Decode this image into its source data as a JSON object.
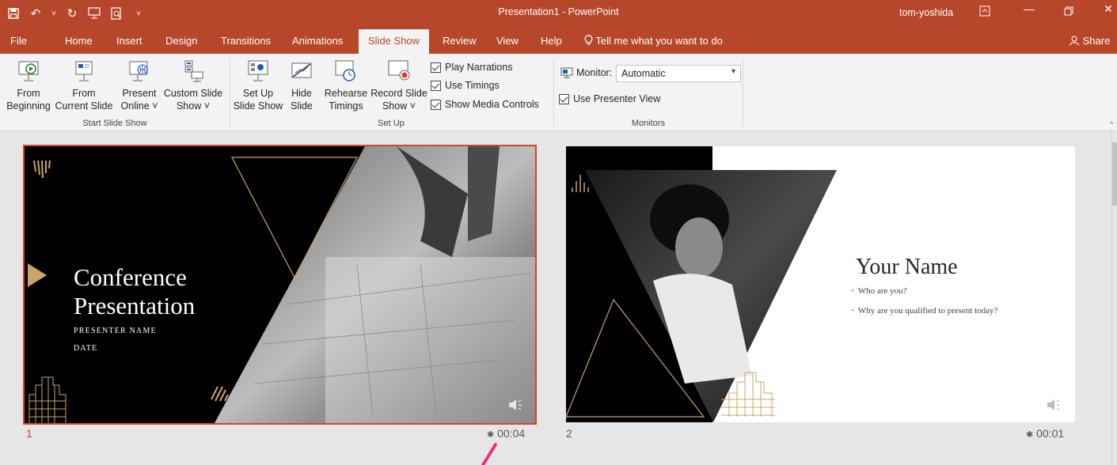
{
  "window": {
    "title": "Presentation1  -  PowerPoint",
    "user": "tom-yoshida"
  },
  "tabs": [
    {
      "label": "File"
    },
    {
      "label": "Home"
    },
    {
      "label": "Insert"
    },
    {
      "label": "Design"
    },
    {
      "label": "Transitions"
    },
    {
      "label": "Animations"
    },
    {
      "label": "Slide Show",
      "active": true
    },
    {
      "label": "Review"
    },
    {
      "label": "View"
    },
    {
      "label": "Help"
    }
  ],
  "tell_me": "Tell me what you want to do",
  "share": "Share",
  "ribbon": {
    "start_group": {
      "label": "Start Slide Show",
      "from_beginning": [
        "From",
        "Beginning"
      ],
      "from_current": [
        "From",
        "Current Slide"
      ],
      "present_online": [
        "Present",
        "Online ˅"
      ],
      "custom_show": [
        "Custom Slide",
        "Show ˅"
      ]
    },
    "setup_group": {
      "label": "Set Up",
      "setup_show": [
        "Set Up",
        "Slide Show"
      ],
      "hide_slide": [
        "Hide",
        "Slide"
      ],
      "rehearse": [
        "Rehearse",
        "Timings"
      ],
      "record": [
        "Record Slide",
        "Show ˅"
      ],
      "play_narrations": "Play Narrations",
      "use_timings": "Use Timings",
      "show_media": "Show Media Controls"
    },
    "monitors_group": {
      "label": "Monitors",
      "monitor_label": "Monitor:",
      "monitor_value": "Automatic",
      "presenter_view": "Use Presenter View"
    }
  },
  "slides": [
    {
      "number": "1",
      "time": "00:04",
      "title_line1": "Conference",
      "title_line2": "Presentation",
      "presenter": "PRESENTER NAME",
      "date": "DATE"
    },
    {
      "number": "2",
      "time": "00:01",
      "name": "Your Name",
      "bullet1": "Who are you?",
      "bullet2": "Why are you qualified to present today?"
    }
  ],
  "colors": {
    "accent": "#b7472a",
    "selection": "#d24726",
    "gold": "#c9a46a"
  }
}
